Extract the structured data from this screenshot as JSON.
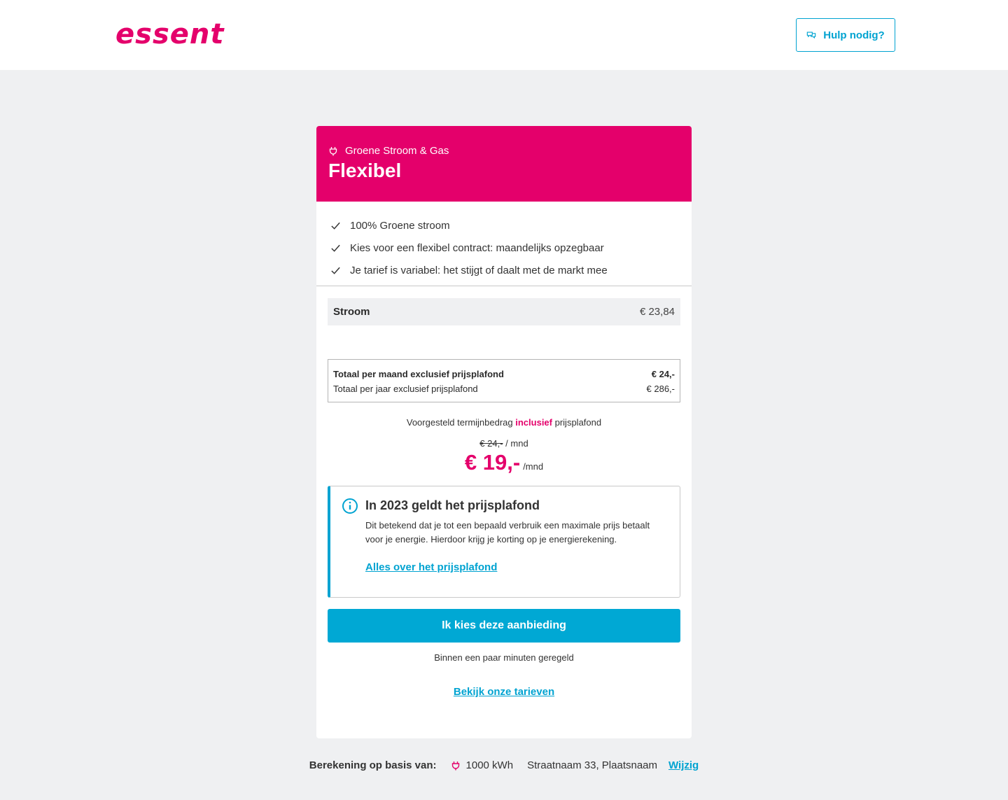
{
  "header": {
    "logo_text": "essent",
    "help_label": "Hulp nodig?"
  },
  "card": {
    "subtitle": "Groene Stroom & Gas",
    "title": "Flexibel",
    "usps": [
      "100% Groene stroom",
      "Kies voor een flexibel contract: maandelijks opzegbaar",
      "Je tarief is variabel: het stijgt of daalt met de markt mee"
    ],
    "stroom": {
      "label": "Stroom",
      "value": "€ 23,84"
    },
    "totals": {
      "month_label": "Totaal per maand exclusief prijsplafond",
      "month_value": "€ 24,-",
      "year_label": "Totaal per jaar exclusief prijsplafond",
      "year_value": "€ 286,-"
    },
    "termijn": {
      "pre": "Voorgesteld termijnbedrag ",
      "accent": "inclusief",
      "post": " prijsplafond"
    },
    "old_price": "€ 24,-",
    "old_price_unit": "/ mnd",
    "new_price": "€ 19,-",
    "new_price_unit": "/mnd",
    "info": {
      "title": "In 2023 geldt het prijsplafond",
      "body": "Dit betekend dat je tot een bepaald verbruik een maximale prijs betaalt voor je energie. Hierdoor krijg je korting op je energierekening.",
      "link": "Alles over het prijsplafond"
    },
    "cta_label": "Ik kies deze aanbieding",
    "cta_note": "Binnen een paar minuten geregeld",
    "tarieven_link": "Bekijk onze tarieven"
  },
  "footer": {
    "label": "Berekening op basis van:",
    "usage": "1000 kWh",
    "address": "Straatnaam 33, Plaatsnaam",
    "change_link": "Wijzig"
  },
  "colors": {
    "brand": "#e4006b",
    "accent": "#00a3d1",
    "background": "#eff0f2"
  },
  "icons": {
    "help": "chat-bubbles-icon",
    "plug": "plug-icon",
    "check": "check-icon",
    "info": "info-icon"
  }
}
